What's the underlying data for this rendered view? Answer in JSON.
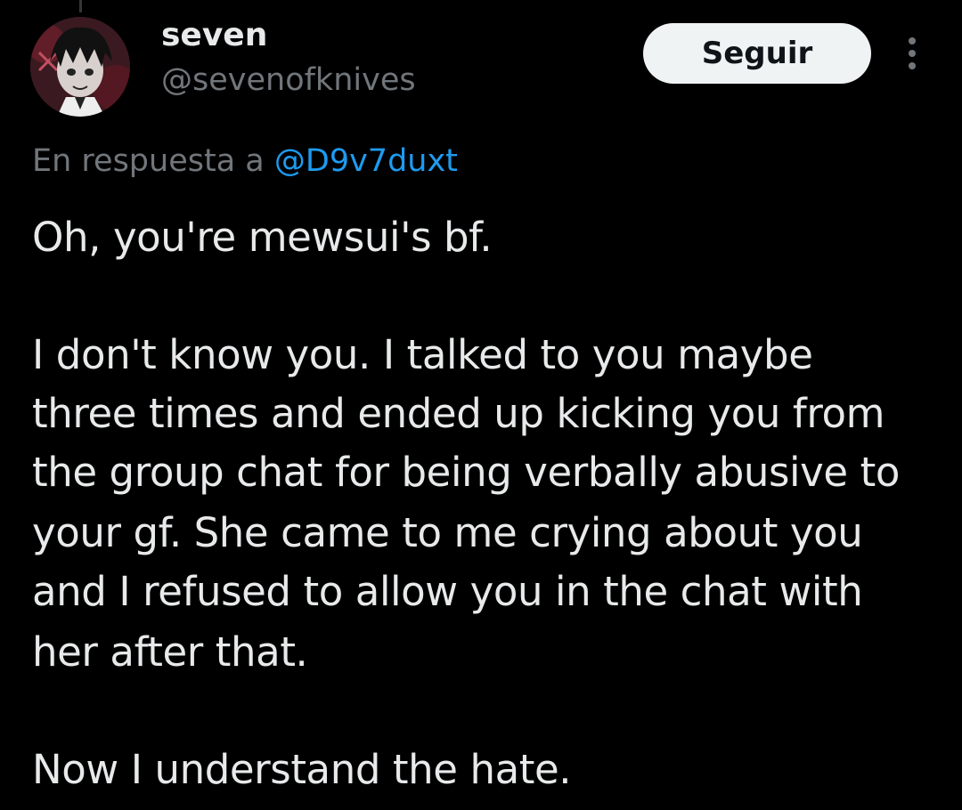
{
  "tweet": {
    "display_name": "seven",
    "handle": "@sevenofknives",
    "follow_label": "Seguir",
    "more_icon": "more-vertical-icon",
    "reply_prefix": "En respuesta a",
    "reply_mention": "@D9v7duxt",
    "body_lines": [
      "Oh, you're mewsui's bf.",
      "I don't know you. I talked to you maybe",
      "three times and ended up kicking you from",
      "the group chat for being verbally abusive to",
      "your gf. She came to me crying about you",
      "and I refused to allow you in the chat with",
      "her after that.",
      "Now I understand the hate."
    ]
  },
  "colors": {
    "background": "#000000",
    "primary_text": "#e7e9ea",
    "secondary_text": "#71767b",
    "link": "#1d9bf0",
    "follow_button_bg": "#eff3f4",
    "follow_button_text": "#0f1419"
  }
}
